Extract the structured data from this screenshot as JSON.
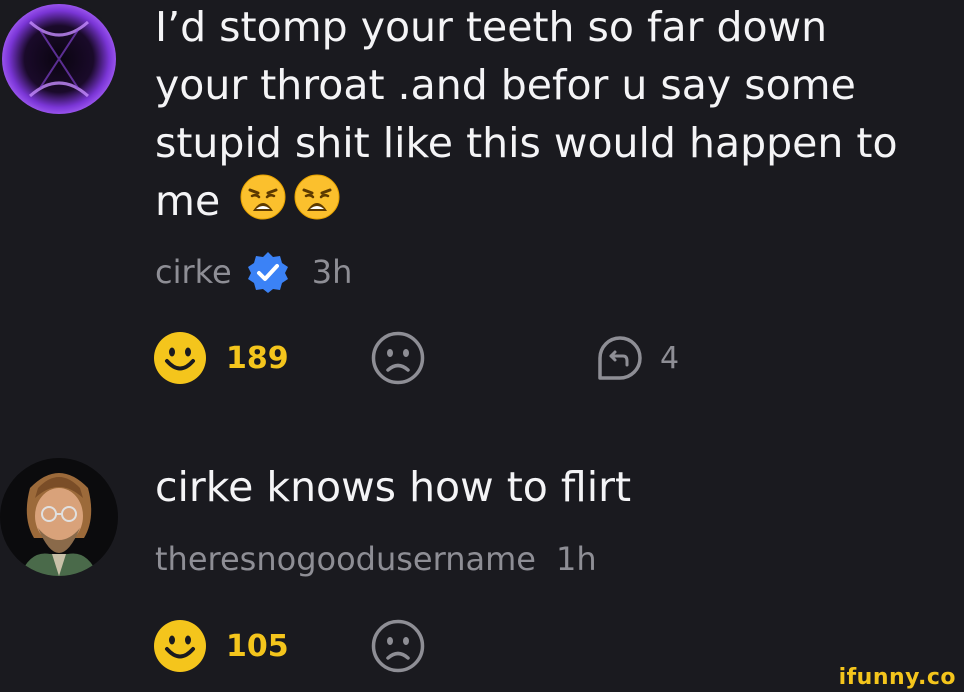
{
  "comments": [
    {
      "text_lines": [
        "I’d stomp your teeth so far down",
        "your throat .and befor u say some",
        "stupid shit like this would happen to",
        "me"
      ],
      "emojis": [
        "weary-face",
        "weary-face"
      ],
      "username": "cirke",
      "verified": true,
      "time": "3h",
      "smile_count": "189",
      "reply_count": "4"
    },
    {
      "text": "cirke knows how to flirt",
      "username": "theresnogoodusername",
      "time": "1h",
      "smile_count": "105"
    }
  ],
  "icons": {
    "smile": "smile-icon",
    "frown": "frown-icon",
    "reply": "reply-icon",
    "verified": "verified-badge-icon"
  },
  "colors": {
    "background": "#1a1a1f",
    "accent_yellow": "#f4c51c",
    "muted_text": "#8e8e95",
    "verified_blue": "#3b82f6"
  },
  "watermark": "ifunny.co"
}
